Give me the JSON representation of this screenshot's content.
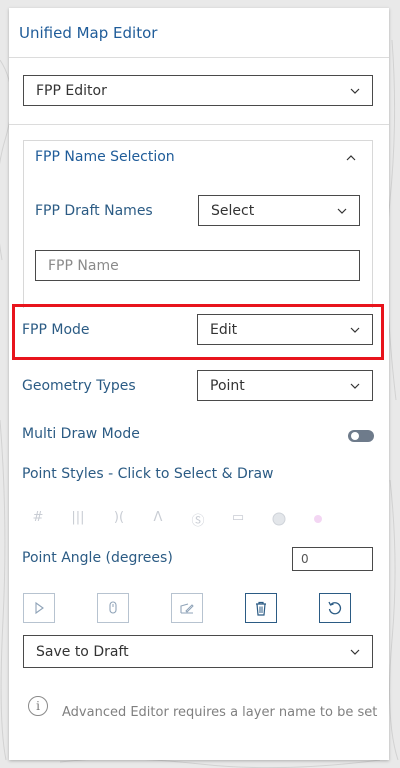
{
  "header": {
    "title": "Unified Map Editor"
  },
  "editor_select": {
    "value": "FPP Editor"
  },
  "fpp_name_selection": {
    "title": "FPP Name Selection",
    "draft_names_label": "FPP Draft Names",
    "draft_names_value": "Select",
    "name_placeholder": "FPP Name"
  },
  "fpp_mode": {
    "label": "FPP Mode",
    "value": "Edit"
  },
  "geometry_types": {
    "label": "Geometry Types",
    "value": "Point"
  },
  "multi_draw_mode": {
    "label": "Multi Draw Mode",
    "enabled": false
  },
  "point_styles": {
    "label": "Point Styles - Click to Select & Draw",
    "icons": [
      "hash-style-icon",
      "bars-style-icon",
      "brackets-style-icon",
      "triangle-style-icon",
      "s-circle-style-icon",
      "rectangle-style-icon",
      "circle-style-icon",
      "dot-style-icon"
    ]
  },
  "point_angle": {
    "label": "Point Angle (degrees)",
    "value": "0"
  },
  "tools": [
    "select-tool",
    "touch-tool",
    "edit-vertices-tool",
    "delete-tool",
    "reset-tool"
  ],
  "save_select": {
    "value": "Save to Draft"
  },
  "info": {
    "text": "Advanced Editor requires a layer name to be set"
  },
  "colors": {
    "accent": "#2b5b84",
    "highlight": "#e8141c",
    "title": "#1f5c99"
  }
}
